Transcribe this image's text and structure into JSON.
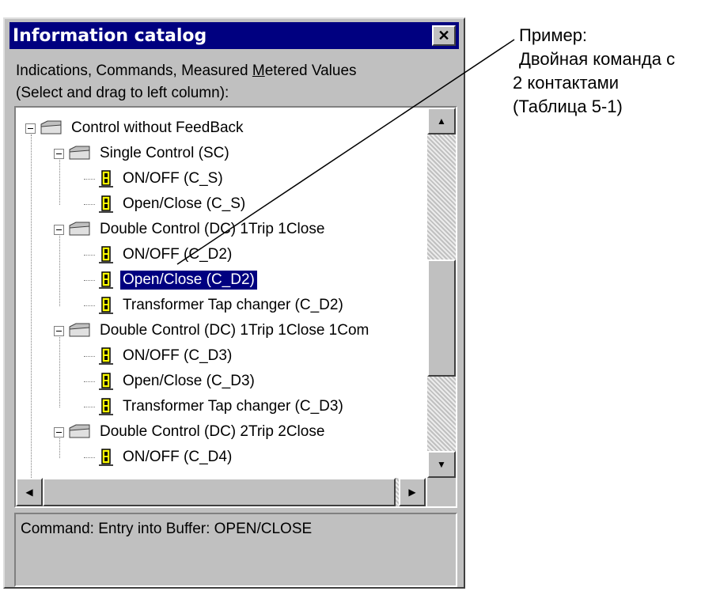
{
  "window": {
    "title": "Information catalog",
    "close_glyph": "✕"
  },
  "instructions": {
    "line1_prefix": "Indications, Commands, Measured ",
    "line1_underlined": "M",
    "line1_suffix": "etered Values",
    "line2": "(Select and drag to left column):"
  },
  "tree": {
    "root": "Control without FeedBack",
    "groups": [
      {
        "label": "Single Control (SC)",
        "items": [
          "ON/OFF (C_S)",
          "Open/Close (C_S)"
        ]
      },
      {
        "label": "Double Control (DC) 1Trip 1Close",
        "items": [
          "ON/OFF (C_D2)",
          "Open/Close (C_D2)",
          "Transformer Tap changer (C_D2)"
        ]
      },
      {
        "label": "Double Control (DC) 1Trip 1Close 1Com",
        "items": [
          "ON/OFF (C_D3)",
          "Open/Close (C_D3)",
          "Transformer Tap changer (C_D3)"
        ]
      },
      {
        "label": "Double Control (DC) 2Trip 2Close",
        "items": [
          "ON/OFF (C_D4)"
        ]
      }
    ],
    "selected": "Open/Close (C_D2)"
  },
  "status": {
    "text": "Command: Entry into Buffer: OPEN/CLOSE"
  },
  "annotation": {
    "line1": "Пример:",
    "line2": "Двойная команда с",
    "line3": "2 контактами",
    "line4": "(Таблица  5-1)"
  },
  "colors": {
    "titlebar": "#000080",
    "selection": "#000080",
    "window_face": "#c0c0c0"
  },
  "icons": [
    "close-icon",
    "folder-icon",
    "command-icon",
    "scroll-up-icon",
    "scroll-down-icon",
    "scroll-left-icon",
    "scroll-right-icon"
  ]
}
